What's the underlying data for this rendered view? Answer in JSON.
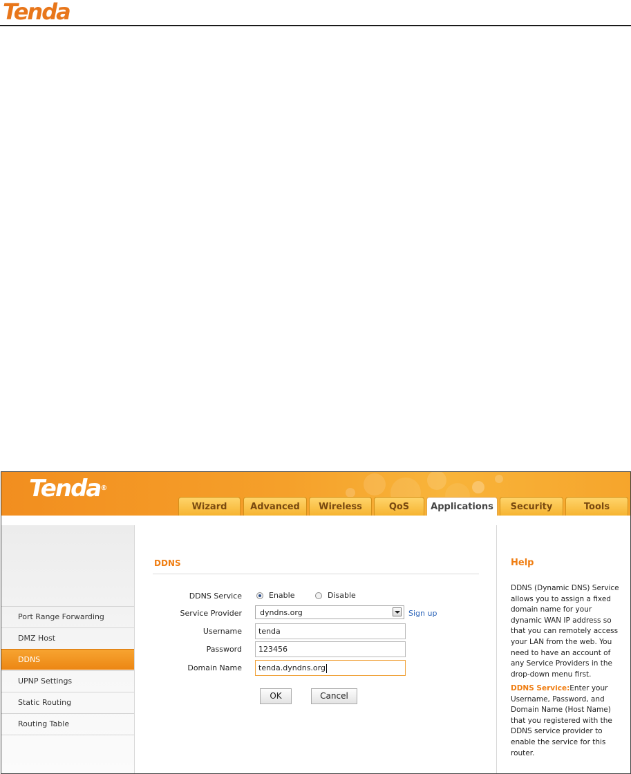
{
  "doc_header": {
    "logo_text": "Tenda"
  },
  "app": {
    "logo_text": "Tenda",
    "logo_mark": "®",
    "tabs": [
      {
        "label": "Wizard"
      },
      {
        "label": "Advanced"
      },
      {
        "label": "Wireless"
      },
      {
        "label": "QoS"
      },
      {
        "label": "Applications",
        "active": true
      },
      {
        "label": "Security"
      },
      {
        "label": "Tools"
      }
    ]
  },
  "sidebar": {
    "items": [
      {
        "label": "Port Range Forwarding"
      },
      {
        "label": "DMZ Host"
      },
      {
        "label": "DDNS",
        "active": true
      },
      {
        "label": "UPNP Settings"
      },
      {
        "label": "Static Routing"
      },
      {
        "label": "Routing Table"
      }
    ]
  },
  "main": {
    "title": "DDNS",
    "ddns_service": {
      "label": "DDNS Service",
      "enable_label": "Enable",
      "disable_label": "Disable",
      "selected": "Enable"
    },
    "service_provider": {
      "label": "Service Provider",
      "value": "dyndns.org",
      "signup_label": "Sign up"
    },
    "username": {
      "label": "Username",
      "value": "tenda"
    },
    "password": {
      "label": "Password",
      "value": "123456"
    },
    "domain_name": {
      "label": "Domain Name",
      "value": "tenda.dyndns.org"
    },
    "ok_label": "OK",
    "cancel_label": "Cancel"
  },
  "help": {
    "title": "Help",
    "paragraph1": "DDNS (Dynamic DNS) Service allows you to assign a fixed domain name for your dynamic WAN IP address so that you can remotely access your LAN from the web. You need to have an account of any Service Providers in the drop-down menu first.",
    "paragraph2_key": "DDNS Service:",
    "paragraph2": "Enter your Username, Password, and Domain Name (Host Name) that you registered with the DDNS service provider to enable the service for this router."
  },
  "colors": {
    "accent": "#ef7d11",
    "link": "#2a63b8"
  }
}
